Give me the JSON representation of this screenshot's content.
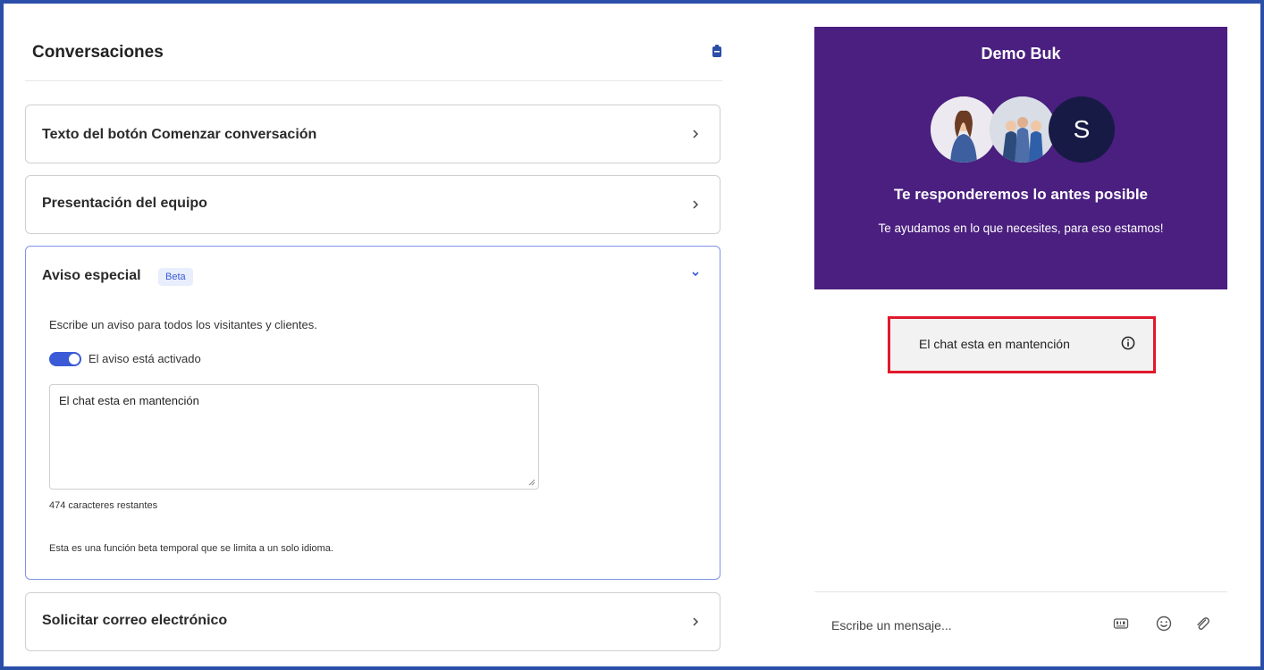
{
  "settings": {
    "title": "Conversaciones",
    "sections": [
      {
        "label": "Texto del botón Comenzar conversación"
      },
      {
        "label": "Presentación del equipo"
      },
      {
        "label": "Aviso especial",
        "badge": "Beta",
        "description": "Escribe un aviso para todos los visitantes y clientes.",
        "toggle_label": "El aviso está activado",
        "toggle_on": true,
        "textarea_value": "El chat esta en mantención",
        "counter": "474 caracteres restantes",
        "note": "Esta es una función beta temporal que se limita a un solo idioma."
      },
      {
        "label": "Solicitar correo electrónico"
      }
    ]
  },
  "widget": {
    "title": "Demo Buk",
    "avatar_initial": "S",
    "heading": "Te responderemos lo antes posible",
    "subheading": "Te ayudamos en lo que necesites, para eso estamos!",
    "notice": "El chat esta en mantención",
    "composer_placeholder": "Escribe un mensaje...",
    "colors": {
      "header_bg": "#4a1f7f",
      "notice_highlight": "#e0192c",
      "accent": "#3a5ad6"
    }
  }
}
